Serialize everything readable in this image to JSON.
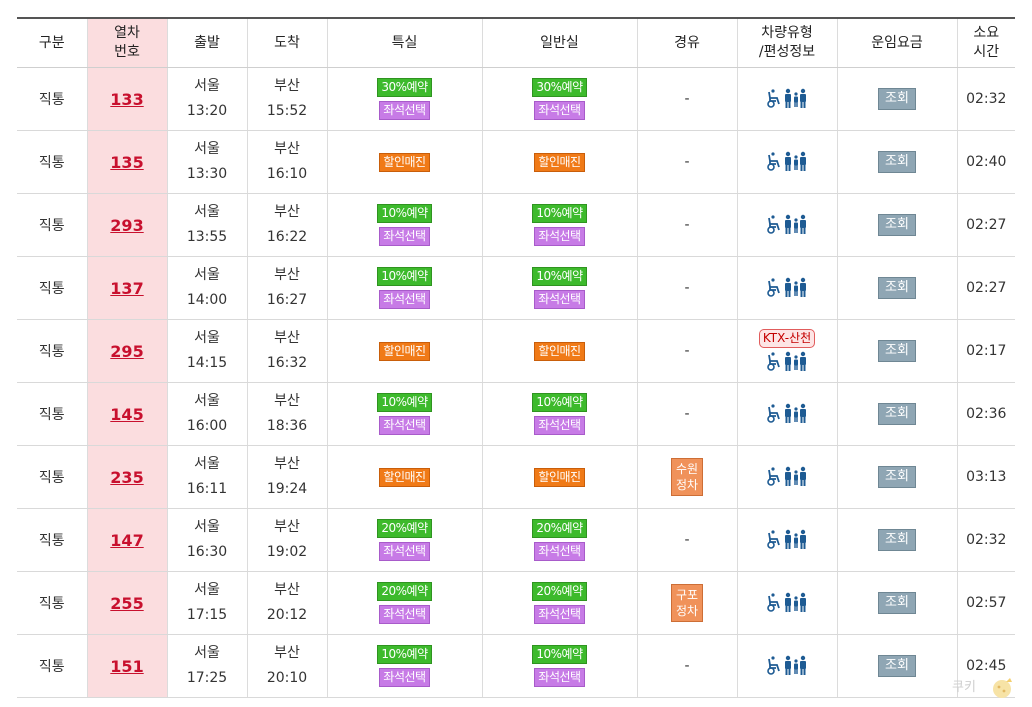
{
  "headers": {
    "type": "구분",
    "train_no_1": "열차",
    "train_no_2": "번호",
    "depart": "출발",
    "arrive": "도착",
    "first_class": "특실",
    "standard": "일반실",
    "via": "경유",
    "vehicle_1": "차량유형",
    "vehicle_2": "/편성정보",
    "fare": "운임요금",
    "duration_1": "소요",
    "duration_2": "시간"
  },
  "fare_label": "조회",
  "rows": [
    {
      "type": "직통",
      "train_no": "133",
      "dep_station": "서울",
      "dep_time": "13:20",
      "arr_station": "부산",
      "arr_time": "15:52",
      "first_class": [
        {
          "text": "30%예약",
          "color": "green"
        },
        {
          "text": "좌석선택",
          "color": "purple"
        }
      ],
      "standard": [
        {
          "text": "30%예약",
          "color": "green"
        },
        {
          "text": "좌석선택",
          "color": "purple"
        }
      ],
      "via_text": "-",
      "via_badge": {
        "line1": "",
        "line2": ""
      },
      "vehicle_tag": "",
      "fare": "조회",
      "duration": "02:32"
    },
    {
      "type": "직통",
      "train_no": "135",
      "dep_station": "서울",
      "dep_time": "13:30",
      "arr_station": "부산",
      "arr_time": "16:10",
      "first_class": [
        {
          "text": "할인매진",
          "color": "orange"
        }
      ],
      "standard": [
        {
          "text": "할인매진",
          "color": "orange"
        }
      ],
      "via_text": "-",
      "via_badge": {
        "line1": "",
        "line2": ""
      },
      "vehicle_tag": "",
      "fare": "조회",
      "duration": "02:40"
    },
    {
      "type": "직통",
      "train_no": "293",
      "dep_station": "서울",
      "dep_time": "13:55",
      "arr_station": "부산",
      "arr_time": "16:22",
      "first_class": [
        {
          "text": "10%예약",
          "color": "green"
        },
        {
          "text": "좌석선택",
          "color": "purple"
        }
      ],
      "standard": [
        {
          "text": "10%예약",
          "color": "green"
        },
        {
          "text": "좌석선택",
          "color": "purple"
        }
      ],
      "via_text": "-",
      "via_badge": {
        "line1": "",
        "line2": ""
      },
      "vehicle_tag": "",
      "fare": "조회",
      "duration": "02:27"
    },
    {
      "type": "직통",
      "train_no": "137",
      "dep_station": "서울",
      "dep_time": "14:00",
      "arr_station": "부산",
      "arr_time": "16:27",
      "first_class": [
        {
          "text": "10%예약",
          "color": "green"
        },
        {
          "text": "좌석선택",
          "color": "purple"
        }
      ],
      "standard": [
        {
          "text": "10%예약",
          "color": "green"
        },
        {
          "text": "좌석선택",
          "color": "purple"
        }
      ],
      "via_text": "-",
      "via_badge": {
        "line1": "",
        "line2": ""
      },
      "vehicle_tag": "",
      "fare": "조회",
      "duration": "02:27"
    },
    {
      "type": "직통",
      "train_no": "295",
      "dep_station": "서울",
      "dep_time": "14:15",
      "arr_station": "부산",
      "arr_time": "16:32",
      "first_class": [
        {
          "text": "할인매진",
          "color": "orange"
        }
      ],
      "standard": [
        {
          "text": "할인매진",
          "color": "orange"
        }
      ],
      "via_text": "-",
      "via_badge": {
        "line1": "",
        "line2": ""
      },
      "vehicle_tag": "KTX-산천",
      "fare": "조회",
      "duration": "02:17"
    },
    {
      "type": "직통",
      "train_no": "145",
      "dep_station": "서울",
      "dep_time": "16:00",
      "arr_station": "부산",
      "arr_time": "18:36",
      "first_class": [
        {
          "text": "10%예약",
          "color": "green"
        },
        {
          "text": "좌석선택",
          "color": "purple"
        }
      ],
      "standard": [
        {
          "text": "10%예약",
          "color": "green"
        },
        {
          "text": "좌석선택",
          "color": "purple"
        }
      ],
      "via_text": "-",
      "via_badge": {
        "line1": "",
        "line2": ""
      },
      "vehicle_tag": "",
      "fare": "조회",
      "duration": "02:36"
    },
    {
      "type": "직통",
      "train_no": "235",
      "dep_station": "서울",
      "dep_time": "16:11",
      "arr_station": "부산",
      "arr_time": "19:24",
      "first_class": [
        {
          "text": "할인매진",
          "color": "orange"
        }
      ],
      "standard": [
        {
          "text": "할인매진",
          "color": "orange"
        }
      ],
      "via_text": "",
      "via_badge": {
        "line1": "수원",
        "line2": "정차"
      },
      "vehicle_tag": "",
      "fare": "조회",
      "duration": "03:13"
    },
    {
      "type": "직통",
      "train_no": "147",
      "dep_station": "서울",
      "dep_time": "16:30",
      "arr_station": "부산",
      "arr_time": "19:02",
      "first_class": [
        {
          "text": "20%예약",
          "color": "green"
        },
        {
          "text": "좌석선택",
          "color": "purple"
        }
      ],
      "standard": [
        {
          "text": "20%예약",
          "color": "green"
        },
        {
          "text": "좌석선택",
          "color": "purple"
        }
      ],
      "via_text": "-",
      "via_badge": {
        "line1": "",
        "line2": ""
      },
      "vehicle_tag": "",
      "fare": "조회",
      "duration": "02:32"
    },
    {
      "type": "직통",
      "train_no": "255",
      "dep_station": "서울",
      "dep_time": "17:15",
      "arr_station": "부산",
      "arr_time": "20:12",
      "first_class": [
        {
          "text": "20%예약",
          "color": "green"
        },
        {
          "text": "좌석선택",
          "color": "purple"
        }
      ],
      "standard": [
        {
          "text": "20%예약",
          "color": "green"
        },
        {
          "text": "좌석선택",
          "color": "purple"
        }
      ],
      "via_text": "",
      "via_badge": {
        "line1": "구포",
        "line2": "정차"
      },
      "vehicle_tag": "",
      "fare": "조회",
      "duration": "02:57"
    },
    {
      "type": "직통",
      "train_no": "151",
      "dep_station": "서울",
      "dep_time": "17:25",
      "arr_station": "부산",
      "arr_time": "20:10",
      "first_class": [
        {
          "text": "10%예약",
          "color": "green"
        },
        {
          "text": "좌석선택",
          "color": "purple"
        }
      ],
      "standard": [
        {
          "text": "10%예약",
          "color": "green"
        },
        {
          "text": "좌석선택",
          "color": "purple"
        }
      ],
      "via_text": "-",
      "via_badge": {
        "line1": "",
        "line2": ""
      },
      "vehicle_tag": "",
      "fare": "조회",
      "duration": "02:45"
    }
  ],
  "watermark": "쿠키",
  "colors": {
    "green": "#3dba2c",
    "purple": "#c77be6",
    "orange": "#f07a17",
    "train_bg": "#fbdddf",
    "train_text": "#c8102e",
    "fare_btn": "#8fa6b4"
  },
  "icons": {
    "vehicle": "wheelchair-family-icon",
    "watermark": "cookie-icon"
  }
}
